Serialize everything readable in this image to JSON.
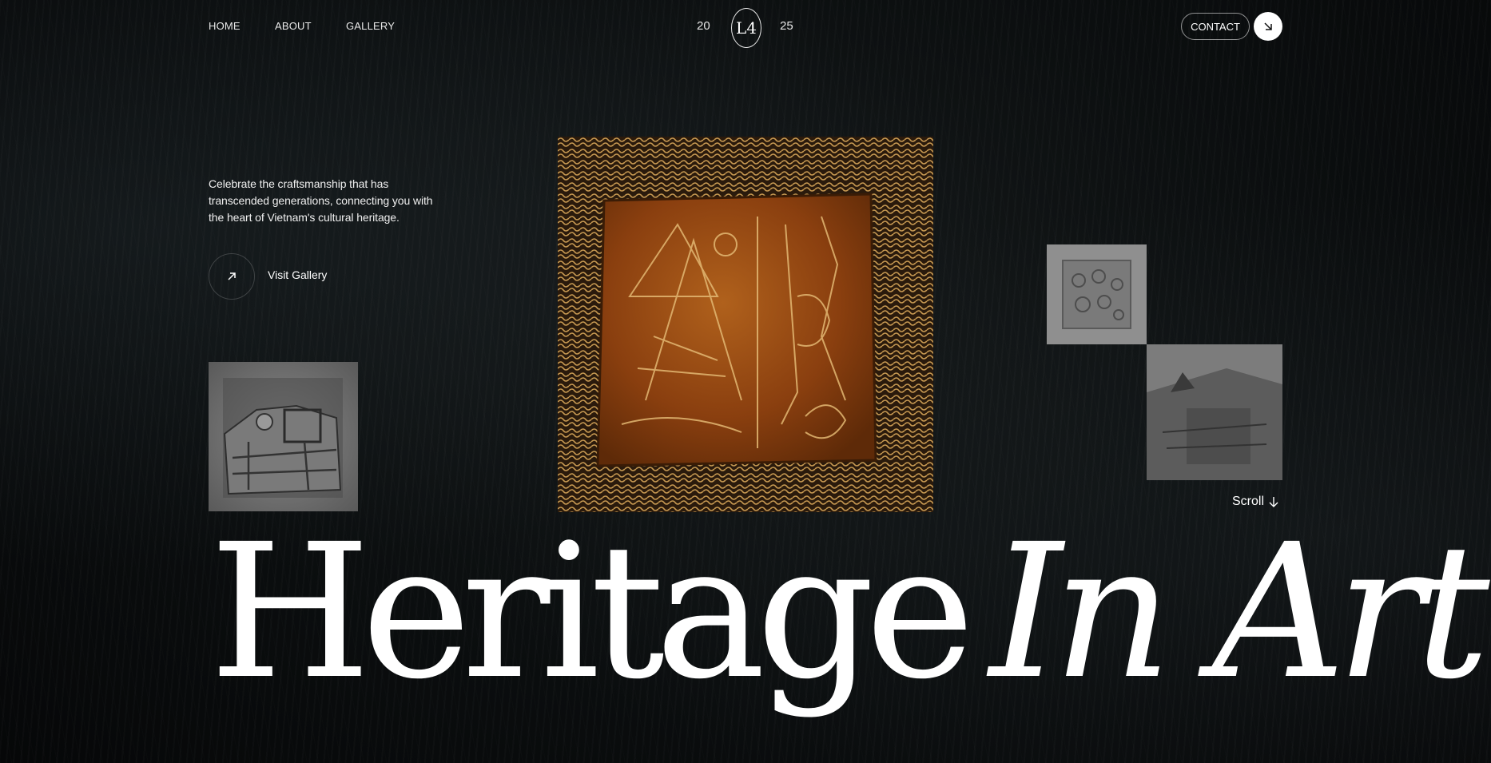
{
  "nav": {
    "home": "HOME",
    "about": "ABOUT",
    "gallery": "GALLERY",
    "year_left": "20",
    "year_right": "25",
    "logo_mark": "L4",
    "contact": "CONTACT",
    "contact_icon": "arrow-down-right-icon"
  },
  "intro": {
    "tagline": "Celebrate the craftsmanship that has transcended generations, connecting you with the heart of Vietnam's cultural heritage.",
    "cta_label": "Visit Gallery",
    "cta_icon": "arrow-up-right-icon"
  },
  "scroll": {
    "label": "Scroll",
    "icon": "arrow-down-icon"
  },
  "hero": {
    "word_regular": "Heritage",
    "word_italic": "In Art"
  },
  "colors": {
    "background": "#0b0e0f",
    "text": "#ffffff",
    "lacquer": "#8a3f0f",
    "gold": "#c89a52"
  }
}
